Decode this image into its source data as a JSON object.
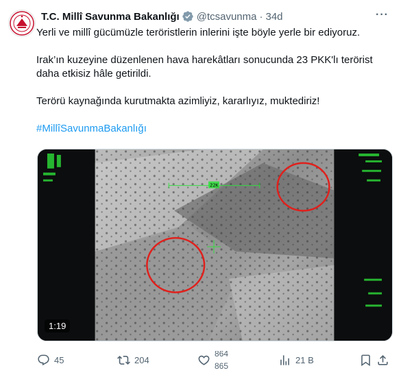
{
  "tweet": {
    "author_name": "T.C. Millî Savunma Bakanlığı",
    "handle": "@tcsavunma",
    "separator": "·",
    "time": "34d",
    "text_line1": "Yerli ve millî gücümüzle teröristlerin inlerini işte böyle yerle bir ediyoruz.",
    "text_para2": "Irak’ın kuzeyine düzenlenen hava harekâtları sonucunda 23 PKK'lı terörist daha etkisiz hâle getirildi.",
    "text_para3": "Terörü kaynağında kurutmakta azimliyiz, kararlıyız, muktediriz!",
    "hashtag": "#MillîSavunmaBakanlığı"
  },
  "media": {
    "video_duration": "1:19",
    "hud_range_label": "22K"
  },
  "actions": {
    "replies": "45",
    "retweets": "204",
    "likes_top": "864",
    "likes_bottom": "865",
    "views": "21 B"
  },
  "colors": {
    "link": "#1d9bf0",
    "muted": "#536471",
    "verified_badge": "#829aab",
    "hud_green": "#2ee03a",
    "target_circle": "#e0201c"
  },
  "icons": [
    "more-icon",
    "verified-badge-icon",
    "reply-icon",
    "retweet-icon",
    "like-icon",
    "views-icon",
    "bookmark-icon",
    "share-icon"
  ]
}
